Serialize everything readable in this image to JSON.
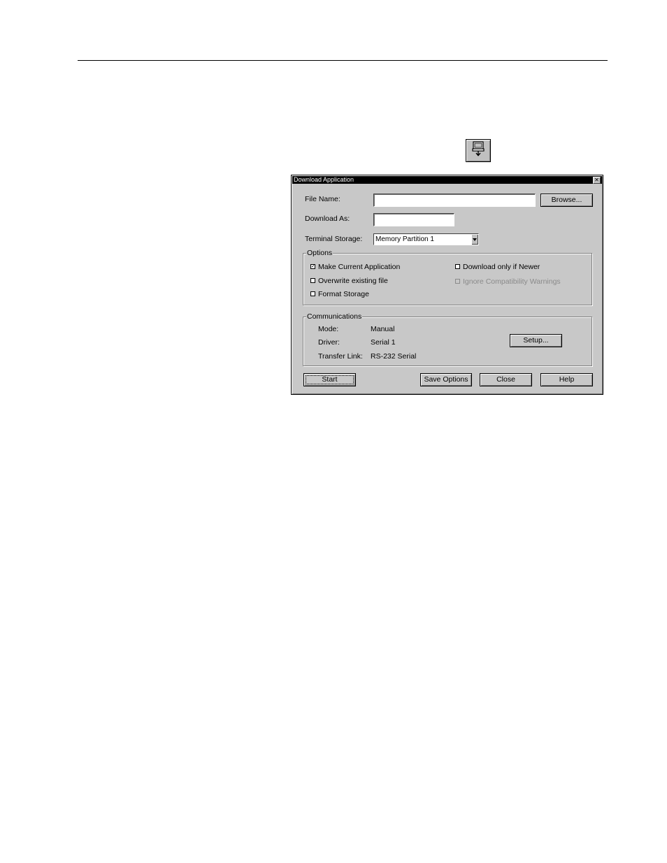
{
  "page": {
    "rule": true
  },
  "dialog": {
    "title": "Download Application",
    "file_name": {
      "label": "File Name:",
      "value": ""
    },
    "browse_label": "Browse...",
    "download_as": {
      "label": "Download As:",
      "value": ""
    },
    "terminal_storage": {
      "label": "Terminal Storage:",
      "value": "Memory Partition 1"
    },
    "options": {
      "title": "Options",
      "make_current": {
        "label": "Make Current Application",
        "checked": true
      },
      "overwrite": {
        "label": "Overwrite existing file",
        "checked": false
      },
      "format_storage": {
        "label": "Format Storage",
        "checked": false
      },
      "download_newer": {
        "label": "Download only if Newer",
        "checked": false
      },
      "ignore_compat": {
        "label": "Ignore Compatibility Warnings",
        "checked": false,
        "disabled": true
      }
    },
    "communications": {
      "title": "Communications",
      "mode_label": "Mode:",
      "mode_value": "Manual",
      "driver_label": "Driver:",
      "driver_value": "Serial 1",
      "link_label": "Transfer Link:",
      "link_value": "RS-232 Serial",
      "setup_label": "Setup..."
    },
    "buttons": {
      "start": "Start",
      "save_options": "Save Options",
      "close": "Close",
      "help": "Help"
    }
  }
}
